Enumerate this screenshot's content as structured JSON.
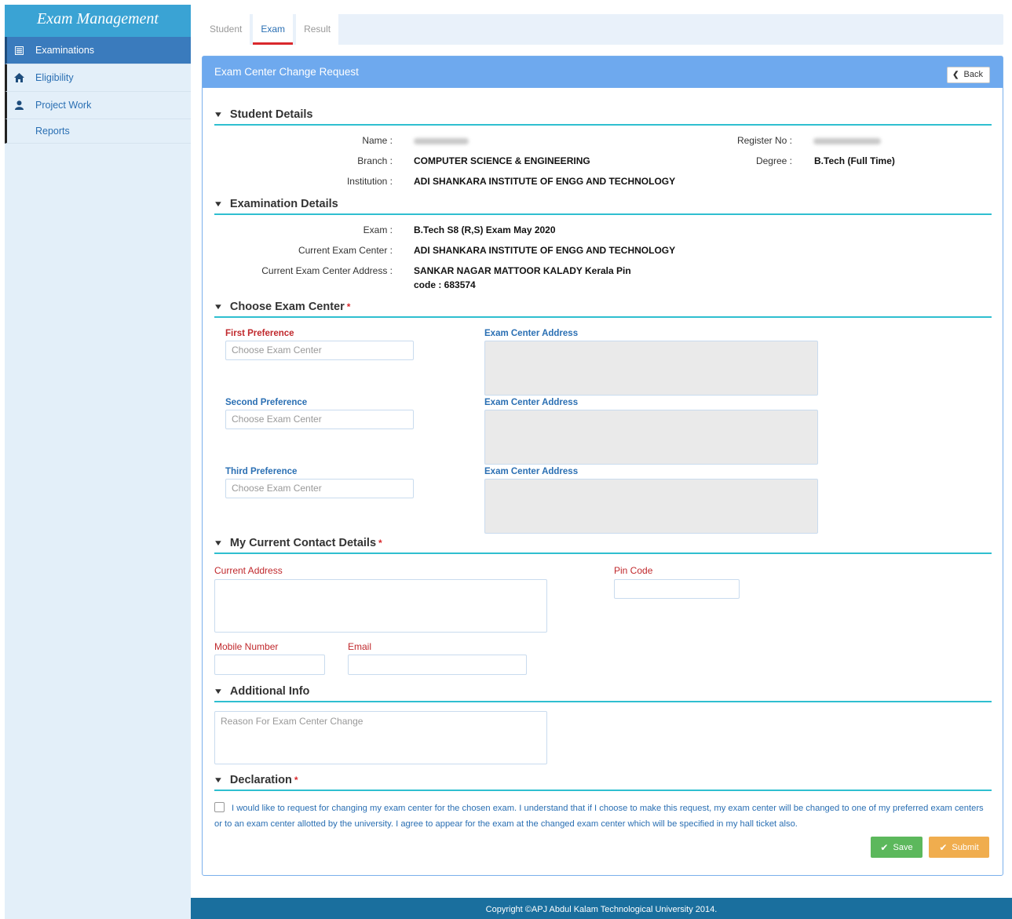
{
  "sidebar": {
    "title": "Exam Management",
    "items": [
      {
        "label": "Examinations",
        "icon": "list-icon",
        "active": true
      },
      {
        "label": "Eligibility",
        "icon": "home-icon",
        "active": false
      },
      {
        "label": "Project Work",
        "icon": "user-icon",
        "active": false
      },
      {
        "label": "Reports",
        "icon": "",
        "active": false
      }
    ]
  },
  "tabs": [
    {
      "label": "Student",
      "active": false
    },
    {
      "label": "Exam",
      "active": true
    },
    {
      "label": "Result",
      "active": false
    }
  ],
  "panel": {
    "title": "Exam Center Change Request",
    "back_label": "Back"
  },
  "student_details": {
    "heading": "Student Details",
    "name_label": "Name :",
    "register_label": "Register No :",
    "branch_label": "Branch :",
    "branch": "COMPUTER SCIENCE & ENGINEERING",
    "degree_label": "Degree :",
    "degree": "B.Tech (Full Time)",
    "institution_label": "Institution :",
    "institution": "ADI SHANKARA INSTITUTE OF ENGG AND TECHNOLOGY"
  },
  "exam_details": {
    "heading": "Examination Details",
    "exam_label": "Exam :",
    "exam": "B.Tech S8 (R,S) Exam May 2020",
    "center_label": "Current Exam Center :",
    "center": "ADI SHANKARA INSTITUTE OF ENGG AND TECHNOLOGY",
    "address_label": "Current Exam Center Address :",
    "address_line1": "SANKAR NAGAR MATTOOR KALADY Kerala Pin",
    "address_line2": "code : 683574"
  },
  "choose_center": {
    "heading": "Choose Exam Center",
    "required_mark": "*",
    "first_label": "First Preference",
    "second_label": "Second Preference",
    "third_label": "Third Preference",
    "placeholder": "Choose Exam Center",
    "address_label": "Exam Center Address"
  },
  "contact": {
    "heading": "My Current Contact Details",
    "required_mark": "*",
    "address_label": "Current Address",
    "pin_label": "Pin Code",
    "mobile_label": "Mobile Number",
    "email_label": "Email"
  },
  "additional": {
    "heading": "Additional Info",
    "reason_placeholder": "Reason For Exam Center Change"
  },
  "declaration": {
    "heading": "Declaration",
    "required_mark": "*",
    "text": "I would like to request for changing my exam center for the chosen exam. I understand that if I choose to make this request, my exam center will be changed to one of my preferred exam centers or to an exam center allotted by the university. I agree to appear for the exam at the changed exam center which will be specified in my hall ticket also."
  },
  "buttons": {
    "save": "Save",
    "submit": "Submit"
  },
  "footer": {
    "text": "Copyright ©APJ Abdul Kalam Technological University 2014."
  },
  "colors": {
    "accent": "#6ea9ee",
    "sidebar_active": "#3a7bbd",
    "section_rule": "#2fbfd0",
    "required": "#d9282c",
    "save": "#5cb85c",
    "submit": "#f0ad4e",
    "footer": "#1a6f9e"
  }
}
